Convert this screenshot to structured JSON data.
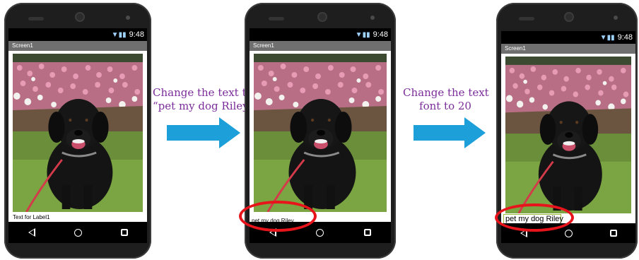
{
  "phones": [
    {
      "status_time": "9:48",
      "screen_title": "Screen1",
      "label_text": "Text for Label1"
    },
    {
      "status_time": "9:48",
      "screen_title": "Screen1",
      "label_text": "pet my dog Riley"
    },
    {
      "status_time": "9:48",
      "screen_title": "Screen1",
      "label_text": "pet my dog Riley"
    }
  ],
  "steps": [
    {
      "caption_line1": "Change the text to",
      "caption_line2": "“pet my dog Riley”"
    },
    {
      "caption_line1": "Change the text",
      "caption_line2": "font to 20"
    }
  ],
  "colors": {
    "arrow": "#1d9fd9",
    "caption": "#7b2d9a",
    "highlight": "#e8141b",
    "label_box": "#9bbc3d"
  },
  "icons": {
    "status": "wifi-signal-battery-icon",
    "nav_back": "back-triangle-icon",
    "nav_home": "home-circle-icon",
    "nav_recent": "recent-square-icon"
  }
}
